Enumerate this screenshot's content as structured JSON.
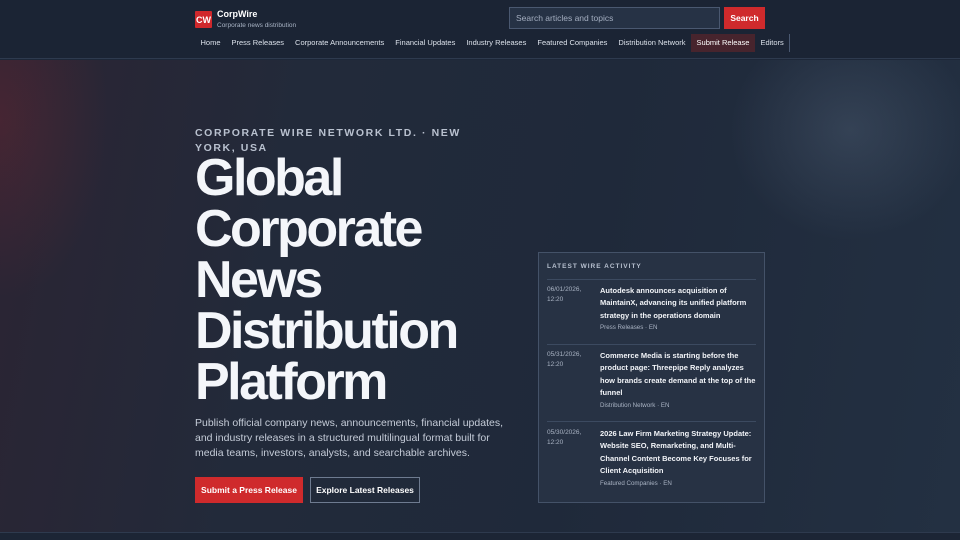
{
  "brand": {
    "logo_text": "CW",
    "name": "CorpWire",
    "tagline": "Corporate news distribution"
  },
  "search": {
    "placeholder": "Search articles and topics",
    "button_label": "Search"
  },
  "nav": {
    "items": [
      {
        "label": "Home"
      },
      {
        "label": "Press Releases"
      },
      {
        "label": "Corporate Announcements"
      },
      {
        "label": "Financial Updates"
      },
      {
        "label": "Industry Releases"
      },
      {
        "label": "Featured Companies"
      },
      {
        "label": "Distribution Network"
      },
      {
        "label": "Submit Release",
        "active": true
      },
      {
        "label": "Editors"
      }
    ]
  },
  "hero": {
    "eyebrow": "CORPORATE WIRE NETWORK LTD. · NEW YORK, USA",
    "title": "Global Corporate News Distribution Platform",
    "description": "Publish official company news, announcements, financial updates, and industry releases in a structured multilingual format built for media teams, investors, analysts, and searchable archives.",
    "primary_cta": "Submit a Press Release",
    "secondary_cta": "Explore Latest Releases"
  },
  "wire_panel": {
    "title": "LATEST WIRE ACTIVITY",
    "items": [
      {
        "date": "06/01/2026, 12:20",
        "headline": "Autodesk announces acquisition of MaintainX, advancing its unified platform strategy in the operations domain",
        "meta": "Press Releases · EN"
      },
      {
        "date": "05/31/2026, 12:20",
        "headline": "Commerce Media is starting before the product page: Threepipe Reply analyzes how brands create demand at the top of the funnel",
        "meta": "Distribution Network · EN"
      },
      {
        "date": "05/30/2026, 12:20",
        "headline": "2026 Law Firm Marketing Strategy Update: Website SEO, Remarketing, and Multi-Channel Content Become Key Focuses for Client Acquisition",
        "meta": "Featured Companies · EN"
      }
    ]
  },
  "colors": {
    "accent": "#cf2a2c",
    "background": "#1d2738",
    "panel": "#273244"
  }
}
